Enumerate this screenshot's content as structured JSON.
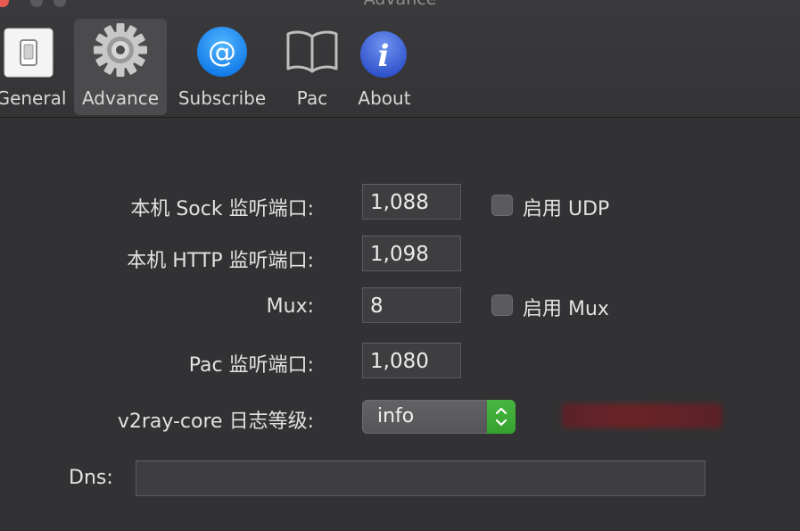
{
  "window": {
    "title": "Advance"
  },
  "toolbar": {
    "items": [
      {
        "label": "General",
        "icon": "switch-icon"
      },
      {
        "label": "Advance",
        "icon": "gear-icon",
        "selected": true
      },
      {
        "label": "Subscribe",
        "icon": "at-sign-icon"
      },
      {
        "label": "Pac",
        "icon": "book-icon"
      },
      {
        "label": "About",
        "icon": "info-icon"
      }
    ]
  },
  "form": {
    "sock_port": {
      "label": "本机 Sock 监听端口:",
      "value": "1,088"
    },
    "udp": {
      "label": "启用 UDP",
      "checked": false
    },
    "http_port": {
      "label": "本机 HTTP 监听端口:",
      "value": "1,098"
    },
    "mux": {
      "label": "Mux:",
      "value": "8"
    },
    "mux_enable": {
      "label": "启用 Mux",
      "checked": false
    },
    "pac_port": {
      "label": "Pac 监听端口:",
      "value": "1,080"
    },
    "log_level": {
      "label": "v2ray-core 日志等级:",
      "value": "info"
    },
    "dns": {
      "label": "Dns:",
      "value": ""
    }
  },
  "colors": {
    "background": "#323234",
    "stepper_accent": "#3aa832",
    "at_icon_blue": "#1d8ef5",
    "info_icon_blue": "#3a63d8"
  }
}
